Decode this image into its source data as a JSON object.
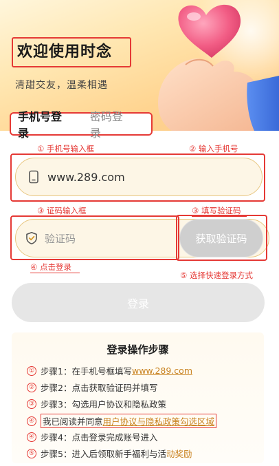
{
  "hero": {
    "title": "欢迎使用时念",
    "subtitle": "清甜交友，温柔相遇"
  },
  "tabs": {
    "phone_login": "手机号登录",
    "password_login": "密码登录"
  },
  "annotations": {
    "a1": "① 手机号输入框",
    "a2": "② 输入手机号",
    "a3_left": "③ 证码输入框",
    "a3_right": "③ 填写验证码",
    "a4": "④ 点击登录",
    "a5": "⑤ 选择快速登录方式"
  },
  "form": {
    "phone_value": "www.289.com",
    "code_placeholder": "验证码",
    "get_code_label": "获取验证码",
    "login_label": "登录"
  },
  "steps": {
    "title": "登录操作步骤",
    "items": [
      {
        "num": "①",
        "text": "步骤1：在手机号框填写 ",
        "link": "www.289.com"
      },
      {
        "num": "②",
        "text": "步骤2：点击获取验证码并填写"
      },
      {
        "num": "③",
        "text": "步骤3：勾选用户协议和隐私政策"
      },
      {
        "num": "④",
        "pre": "我已阅读并同意",
        "highlight": "用户协议与隐私政策勾选区域"
      },
      {
        "num": "④",
        "text": "步骤4：点击登录完成账号进入"
      },
      {
        "num": "⑤",
        "text": "步骤5：进入后领取新手福利与活",
        "orange": "动奖励"
      }
    ]
  },
  "colors": {
    "annotation_red": "#e53935",
    "accent_orange": "#c9821f",
    "field_border": "#e8c680"
  },
  "icons": {
    "phone": "phone-icon",
    "shield": "shield-check-icon",
    "hero": "heart-hand-icon"
  }
}
